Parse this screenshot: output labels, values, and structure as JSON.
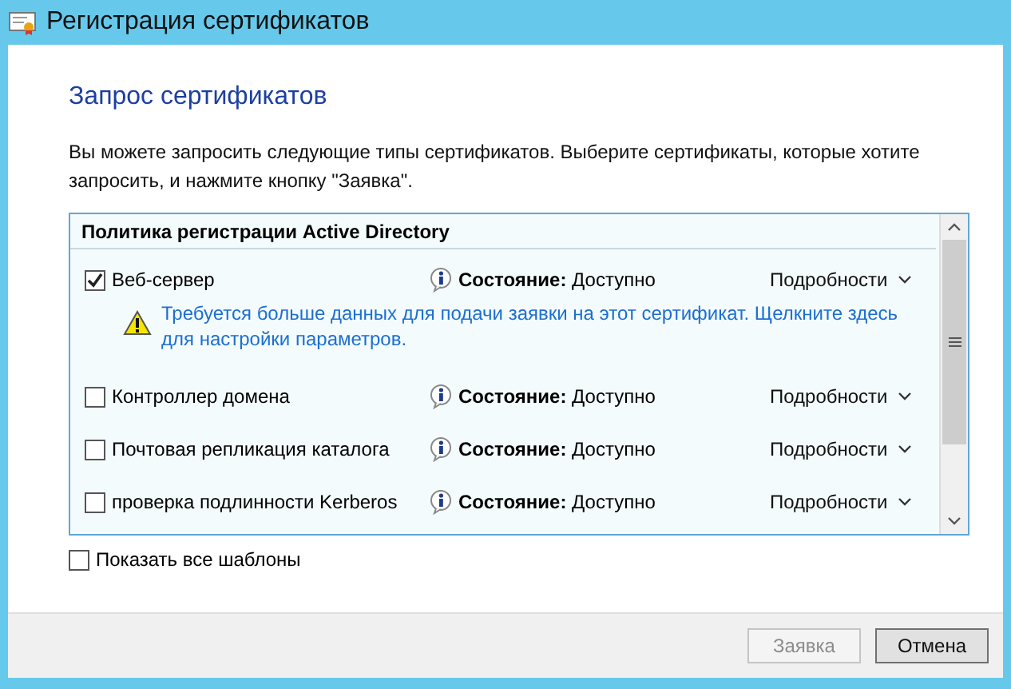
{
  "window": {
    "title": "Регистрация сертификатов"
  },
  "heading": "Запрос сертификатов",
  "description": "Вы можете запросить следующие типы сертификатов. Выберите сертификаты, которые хотите запросить, и нажмите кнопку \"Заявка\".",
  "list": {
    "group_title": "Политика регистрации Active Directory",
    "items": [
      {
        "name": "Веб-сервер",
        "checked": true,
        "status": "**Состояние:** Доступно",
        "details": "Подробности",
        "warning": "Требуется больше данных для подачи заявки на этот сертификат. Щелкните здесь для настройки параметров."
      },
      {
        "name": "Контроллер домена",
        "checked": false,
        "status": "**Состояние:** Доступно",
        "details": "Подробности"
      },
      {
        "name": "Почтовая репликация каталога",
        "checked": false,
        "status": "**Состояние:** Доступно",
        "details": "Подробности"
      },
      {
        "name": "проверка подлинности Kerberos",
        "checked": false,
        "status": "**Состояние:** Доступно",
        "details": "Подробности"
      }
    ]
  },
  "show_all": {
    "label": "Показать все шаблоны",
    "checked": false
  },
  "buttons": [
    {
      "label": "Заявка",
      "disabled": true
    },
    {
      "label": "Отмена",
      "disabled": false
    }
  ]
}
